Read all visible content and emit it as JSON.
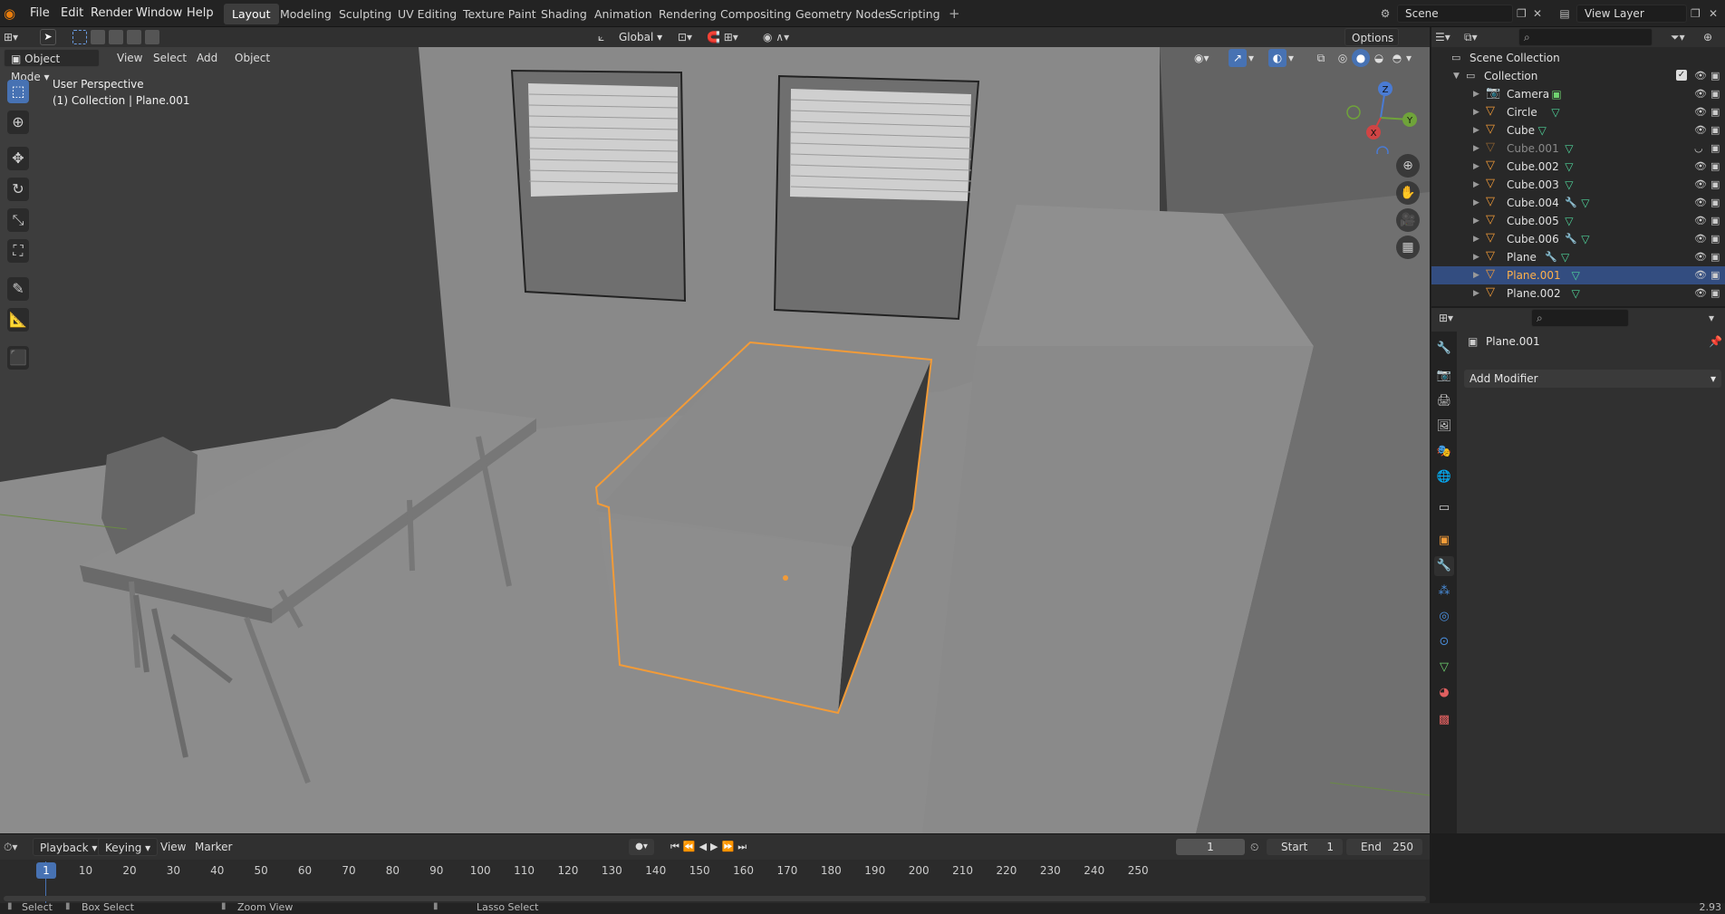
{
  "topbar": {
    "menus": [
      "File",
      "Edit",
      "Render",
      "Window",
      "Help"
    ],
    "workspaces": [
      "Layout",
      "Modeling",
      "Sculpting",
      "UV Editing",
      "Texture Paint",
      "Shading",
      "Animation",
      "Rendering",
      "Compositing",
      "Geometry Nodes",
      "Scripting"
    ],
    "active_workspace": "Layout",
    "add_tab": "+",
    "scene": "Scene",
    "view_layer": "View Layer"
  },
  "header": {
    "mode": "Object Mode",
    "menus": [
      "View",
      "Select",
      "Add",
      "Object"
    ],
    "transform": "Global",
    "options": "Options"
  },
  "viewport": {
    "perspective": "User Perspective",
    "collection_info": "(1) Collection | Plane.001",
    "gizmo": {
      "x": "X",
      "y": "Y",
      "z": "Z"
    }
  },
  "outliner": {
    "root": "Scene Collection",
    "collection": "Collection",
    "items": [
      {
        "name": "Camera",
        "kind": "camera"
      },
      {
        "name": "Circle",
        "kind": "mesh"
      },
      {
        "name": "Cube",
        "kind": "mesh"
      },
      {
        "name": "Cube.001",
        "kind": "mesh",
        "hidden": true
      },
      {
        "name": "Cube.002",
        "kind": "mesh"
      },
      {
        "name": "Cube.003",
        "kind": "mesh"
      },
      {
        "name": "Cube.004",
        "kind": "mesh",
        "modifier": true
      },
      {
        "name": "Cube.005",
        "kind": "mesh"
      },
      {
        "name": "Cube.006",
        "kind": "mesh",
        "modifier": true
      },
      {
        "name": "Plane",
        "kind": "mesh",
        "modifier": true
      },
      {
        "name": "Plane.001",
        "kind": "mesh",
        "selected": true
      },
      {
        "name": "Plane.002",
        "kind": "mesh"
      }
    ]
  },
  "properties": {
    "object": "Plane.001",
    "add_modifier": "Add Modifier"
  },
  "timeline": {
    "menus": [
      "Playback",
      "Keying",
      "View",
      "Marker"
    ],
    "current_frame": "1",
    "start_label": "Start",
    "start": "1",
    "end_label": "End",
    "end": "250",
    "ticks": [
      "1",
      "10",
      "20",
      "30",
      "40",
      "50",
      "60",
      "70",
      "80",
      "90",
      "100",
      "110",
      "120",
      "130",
      "140",
      "150",
      "160",
      "170",
      "180",
      "190",
      "200",
      "210",
      "220",
      "230",
      "240",
      "250"
    ]
  },
  "status": {
    "items": [
      "Select",
      "Box Select",
      "Zoom View",
      "Lasso Select"
    ],
    "version": "2.93"
  },
  "colors": {
    "accent": "#4772b3",
    "selection": "#f29b38",
    "viewport": "#3d3d3d"
  }
}
